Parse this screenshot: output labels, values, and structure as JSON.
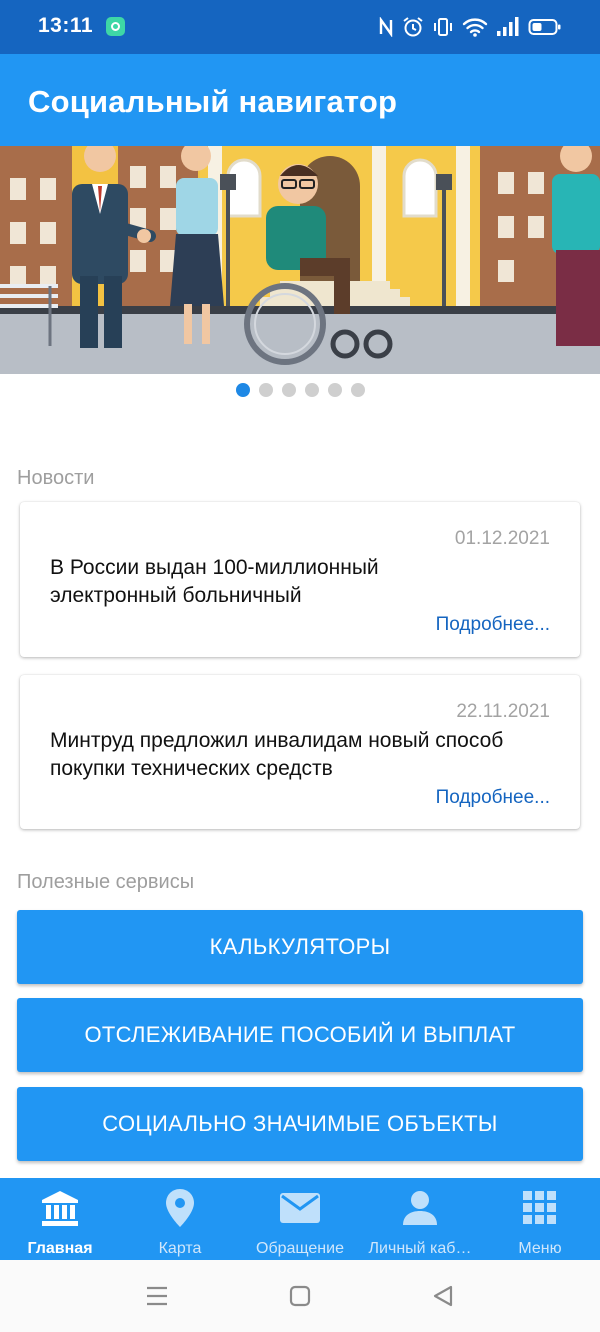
{
  "status_bar": {
    "time": "13:11",
    "icons": [
      "app-notification-icon",
      "nfc-icon",
      "alarm-icon",
      "vibrate-icon",
      "wifi-icon",
      "signal-icon",
      "battery-icon"
    ]
  },
  "app_bar": {
    "title": "Социальный навигатор"
  },
  "banner": {
    "slide_count": 6,
    "active_slide": 1
  },
  "news": {
    "label": "Новости",
    "items": [
      {
        "date": "01.12.2021",
        "headline": "В России выдан 100-миллионный электронный больничный",
        "more": "Подробнее..."
      },
      {
        "date": "22.11.2021",
        "headline": "Минтруд предложил инвалидам новый способ покупки технических средств",
        "more": "Подробнее..."
      }
    ]
  },
  "services": {
    "label": "Полезные сервисы",
    "buttons": [
      "КАЛЬКУЛЯТОРЫ",
      "ОТСЛЕЖИВАНИЕ ПОСОБИЙ И ВЫПЛАТ",
      "СОЦИАЛЬНО ЗНАЧИМЫЕ ОБЪЕКТЫ"
    ]
  },
  "bottom_nav": {
    "items": [
      {
        "label": "Главная",
        "icon": "home-building-icon",
        "active": true
      },
      {
        "label": "Карта",
        "icon": "map-pin-icon",
        "active": false
      },
      {
        "label": "Обращение",
        "icon": "envelope-icon",
        "active": false
      },
      {
        "label": "Личный каб…",
        "icon": "person-icon",
        "active": false
      },
      {
        "label": "Меню",
        "icon": "grid-menu-icon",
        "active": false
      }
    ]
  },
  "system_nav": {
    "icons": [
      "recents-icon",
      "home-icon",
      "back-icon"
    ]
  },
  "colors": {
    "primary": "#2196f3",
    "status_bar": "#1565c0",
    "link": "#1565c0",
    "dot_active": "#1e88e5"
  }
}
